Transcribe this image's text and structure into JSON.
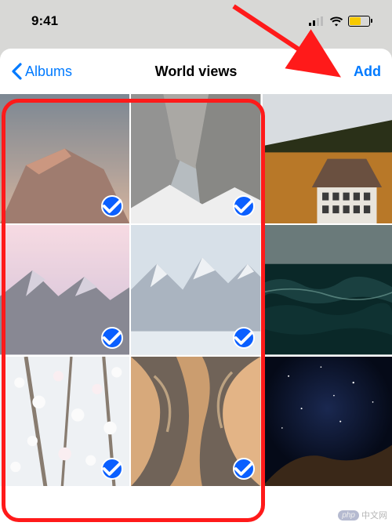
{
  "status": {
    "time": "9:41"
  },
  "nav": {
    "back_label": "Albums",
    "title": "World views",
    "add_label": "Add"
  },
  "photos": [
    {
      "name": "mountain-sunset",
      "selected": true
    },
    {
      "name": "snowy-peaks",
      "selected": true
    },
    {
      "name": "autumn-house",
      "selected": false
    },
    {
      "name": "pink-mountains",
      "selected": true
    },
    {
      "name": "glacier-ridge",
      "selected": true
    },
    {
      "name": "dark-ocean",
      "selected": false
    },
    {
      "name": "cherry-blossoms",
      "selected": true
    },
    {
      "name": "antelope-canyon",
      "selected": true
    },
    {
      "name": "night-sky",
      "selected": false
    }
  ],
  "watermark": {
    "text": "中文网",
    "badge": "php"
  },
  "colors": {
    "ios_blue": "#007aff",
    "select_blue": "#0a5fff",
    "annotation_red": "#ff1a1a",
    "battery_yellow": "#f7ca00"
  }
}
